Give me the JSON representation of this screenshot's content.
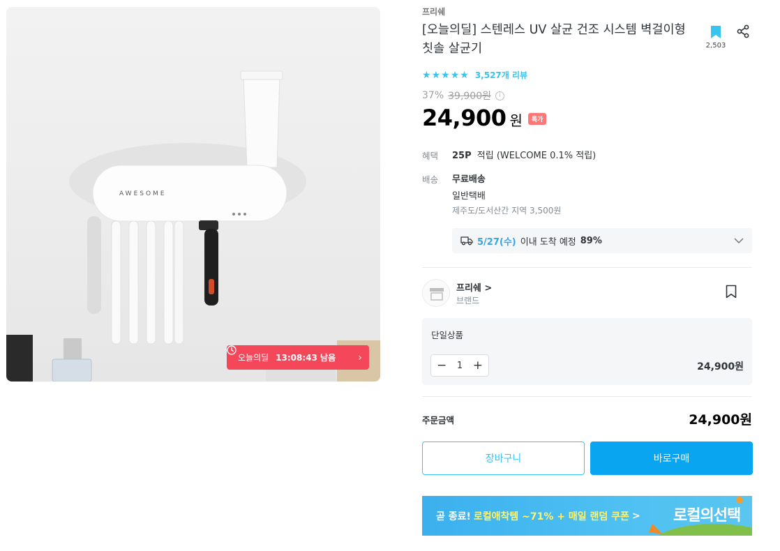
{
  "product_image": {
    "alt": "AWESOME UV sterilizer",
    "device_logo": "AWESOME",
    "deal_badge": {
      "label": "오늘의딜",
      "timer": "13:08:43 남음"
    }
  },
  "product": {
    "brand": "프리쉐",
    "title": "[오늘의딜] 스텐레스 UV 살균 건조 시스템 벽걸이형 칫솔 살균기",
    "bookmark_count": "2,503",
    "rating_stars": 5,
    "reviews": "3,527개 리뷰",
    "discount": "37%",
    "original_price": "39,900원",
    "price": "24,900",
    "currency": "원",
    "special_badge": "특가"
  },
  "benefit": {
    "label": "혜택",
    "points": "25P",
    "text": "적립 (WELCOME 0.1% 적립)"
  },
  "shipping": {
    "label": "배송",
    "free": "무료배송",
    "type": "일반택배",
    "extra": "제주도/도서산간 지역 3,500원",
    "eta_date": "5/27(수)",
    "eta_text": "이내 도착 예정",
    "eta_pct": "89%"
  },
  "store": {
    "name": "프리쉐",
    "chevron": ">",
    "type": "브랜드"
  },
  "option": {
    "name": "단일상품",
    "quantity": "1",
    "price": "24,900원"
  },
  "order": {
    "label": "주문금액",
    "total": "24,900원"
  },
  "buttons": {
    "cart": "장바구니",
    "buy": "바로구매"
  },
  "banner": {
    "prefix": "곧 종료!",
    "highlight": "로컬애착템 ~71% + 매일 랜덤 쿠폰",
    "arrow": ">",
    "logo": "로컬의선택"
  },
  "colors": {
    "accent": "#35c5f0",
    "buy": "#0aa5f0",
    "deal": "#f4475a"
  }
}
